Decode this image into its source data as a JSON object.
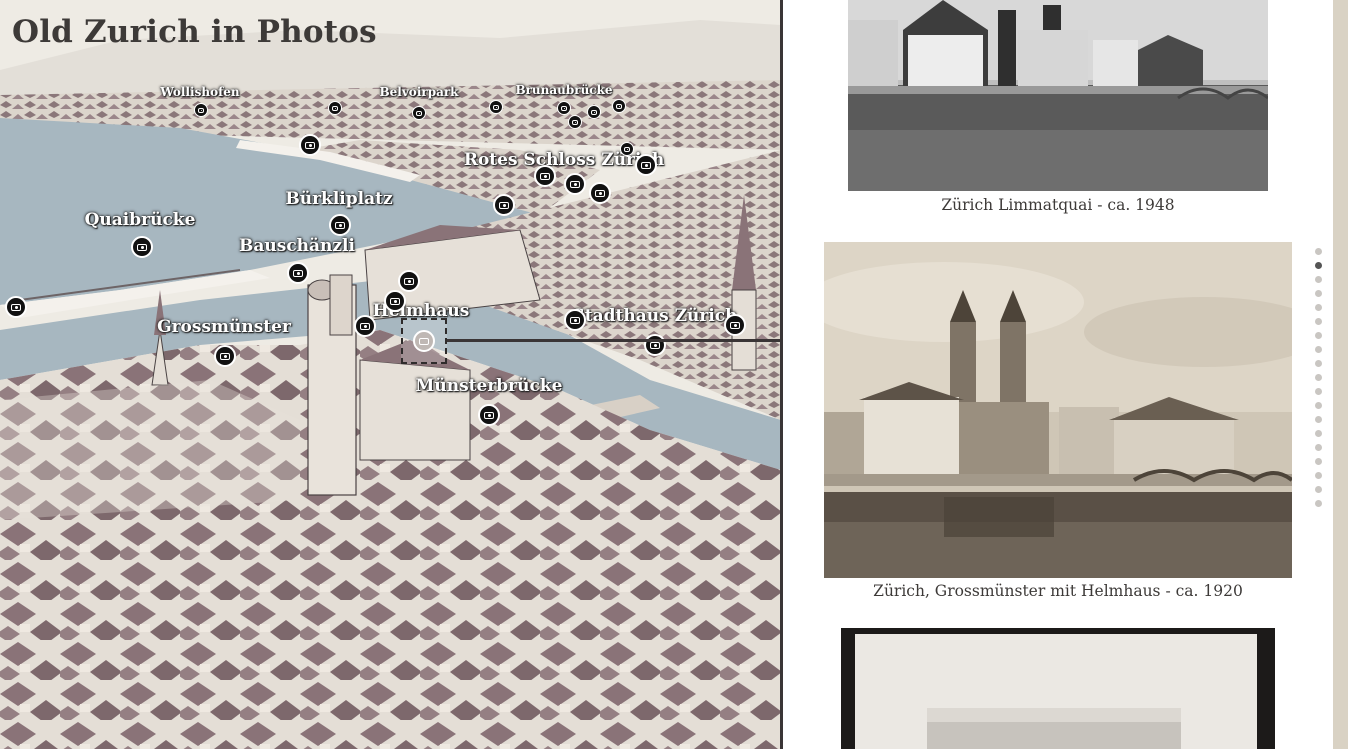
{
  "app": {
    "title": "Old Zurich in Photos"
  },
  "map": {
    "labels": [
      {
        "text": "Wollishofen",
        "size": "small"
      },
      {
        "text": "Belvoirpark",
        "size": "small"
      },
      {
        "text": "Brunaubrücke",
        "size": "small"
      },
      {
        "text": "Rotes Schloss Zürich",
        "size": "big"
      },
      {
        "text": "Bürkliplatz",
        "size": "big"
      },
      {
        "text": "Quaibrücke",
        "size": "big"
      },
      {
        "text": "Bauschänzli",
        "size": "big"
      },
      {
        "text": "Helmhaus",
        "size": "big"
      },
      {
        "text": "Stadthaus Zürich",
        "size": "big"
      },
      {
        "text": "Grossmünster",
        "size": "big"
      },
      {
        "text": "Münsterbrücke",
        "size": "big"
      }
    ],
    "pin_icon": "camera-icon",
    "selected_pin": "Helmhaus"
  },
  "gallery": {
    "photos": [
      {
        "caption": "Zürich Limmatquai - ca. 1948",
        "tone": "bw"
      },
      {
        "caption": "Zürich, Grossmünster mit Helmhaus - ca. 1920",
        "tone": "sepia"
      },
      {
        "caption": "",
        "tone": "print"
      }
    ],
    "progress": {
      "total": 19,
      "active_index": 1
    }
  },
  "colors": {
    "water": "#a7b7c0",
    "roof": "#8a7378",
    "wall": "#e6e0d8",
    "background": "#eeebe4"
  }
}
